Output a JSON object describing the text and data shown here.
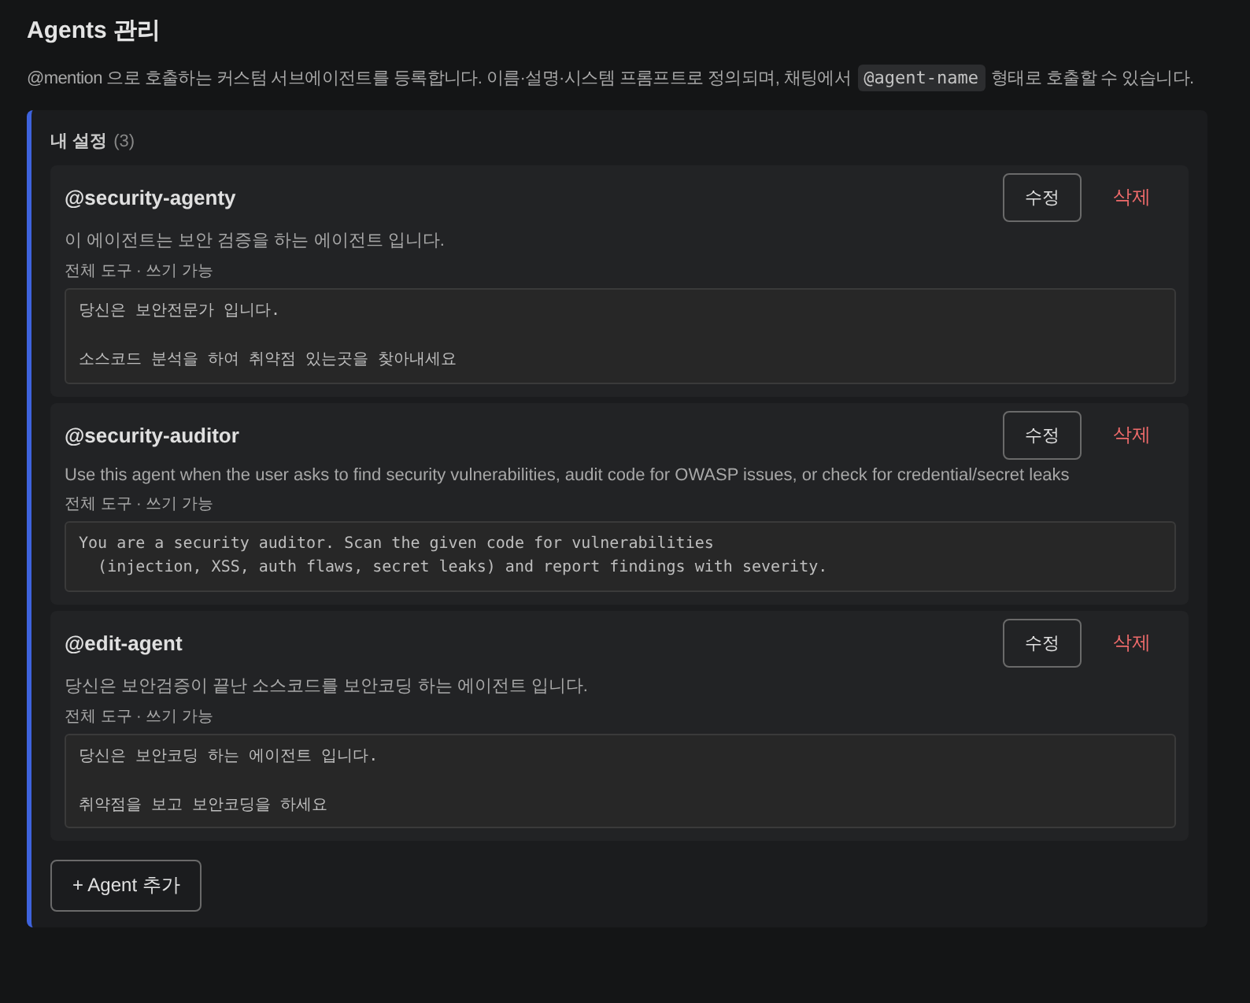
{
  "title": "Agents 관리",
  "description": {
    "before": "@mention 으로 호출하는 커스텀 서브에이전트를 등록합니다. 이름·설명·시스템 프롬프트로 정의되며, 채팅에서",
    "code": "@agent-name",
    "after": "형태로 호출할 수 있습니다."
  },
  "section": {
    "title": "내 설정",
    "count": "(3)",
    "agents": [
      {
        "name": "@security-agenty",
        "description": "이 에이전트는 보안 검증을 하는 에이전트 입니다.",
        "meta": "전체 도구 · 쓰기 가능",
        "prompt": "당신은 보안전문가 입니다.\n\n소스코드 분석을 하여 취약점 있는곳을 찾아내세요",
        "edit": "수정",
        "delete": "삭제"
      },
      {
        "name": "@security-auditor",
        "description": "Use this agent when the user asks to find security vulnerabilities, audit code for OWASP issues, or check for credential/secret leaks",
        "meta": "전체 도구 · 쓰기 가능",
        "prompt": "You are a security auditor. Scan the given code for vulnerabilities\n  (injection, XSS, auth flaws, secret leaks) and report findings with severity.",
        "edit": "수정",
        "delete": "삭제"
      },
      {
        "name": "@edit-agent",
        "description": "당신은 보안검증이 끝난 소스코드를 보안코딩 하는 에이전트 입니다.",
        "meta": "전체 도구 · 쓰기 가능",
        "prompt": "당신은 보안코딩 하는 에이전트 입니다.\n\n취약점을 보고 보안코딩을 하세요",
        "edit": "수정",
        "delete": "삭제"
      }
    ],
    "add_button": "+ Agent 추가"
  }
}
